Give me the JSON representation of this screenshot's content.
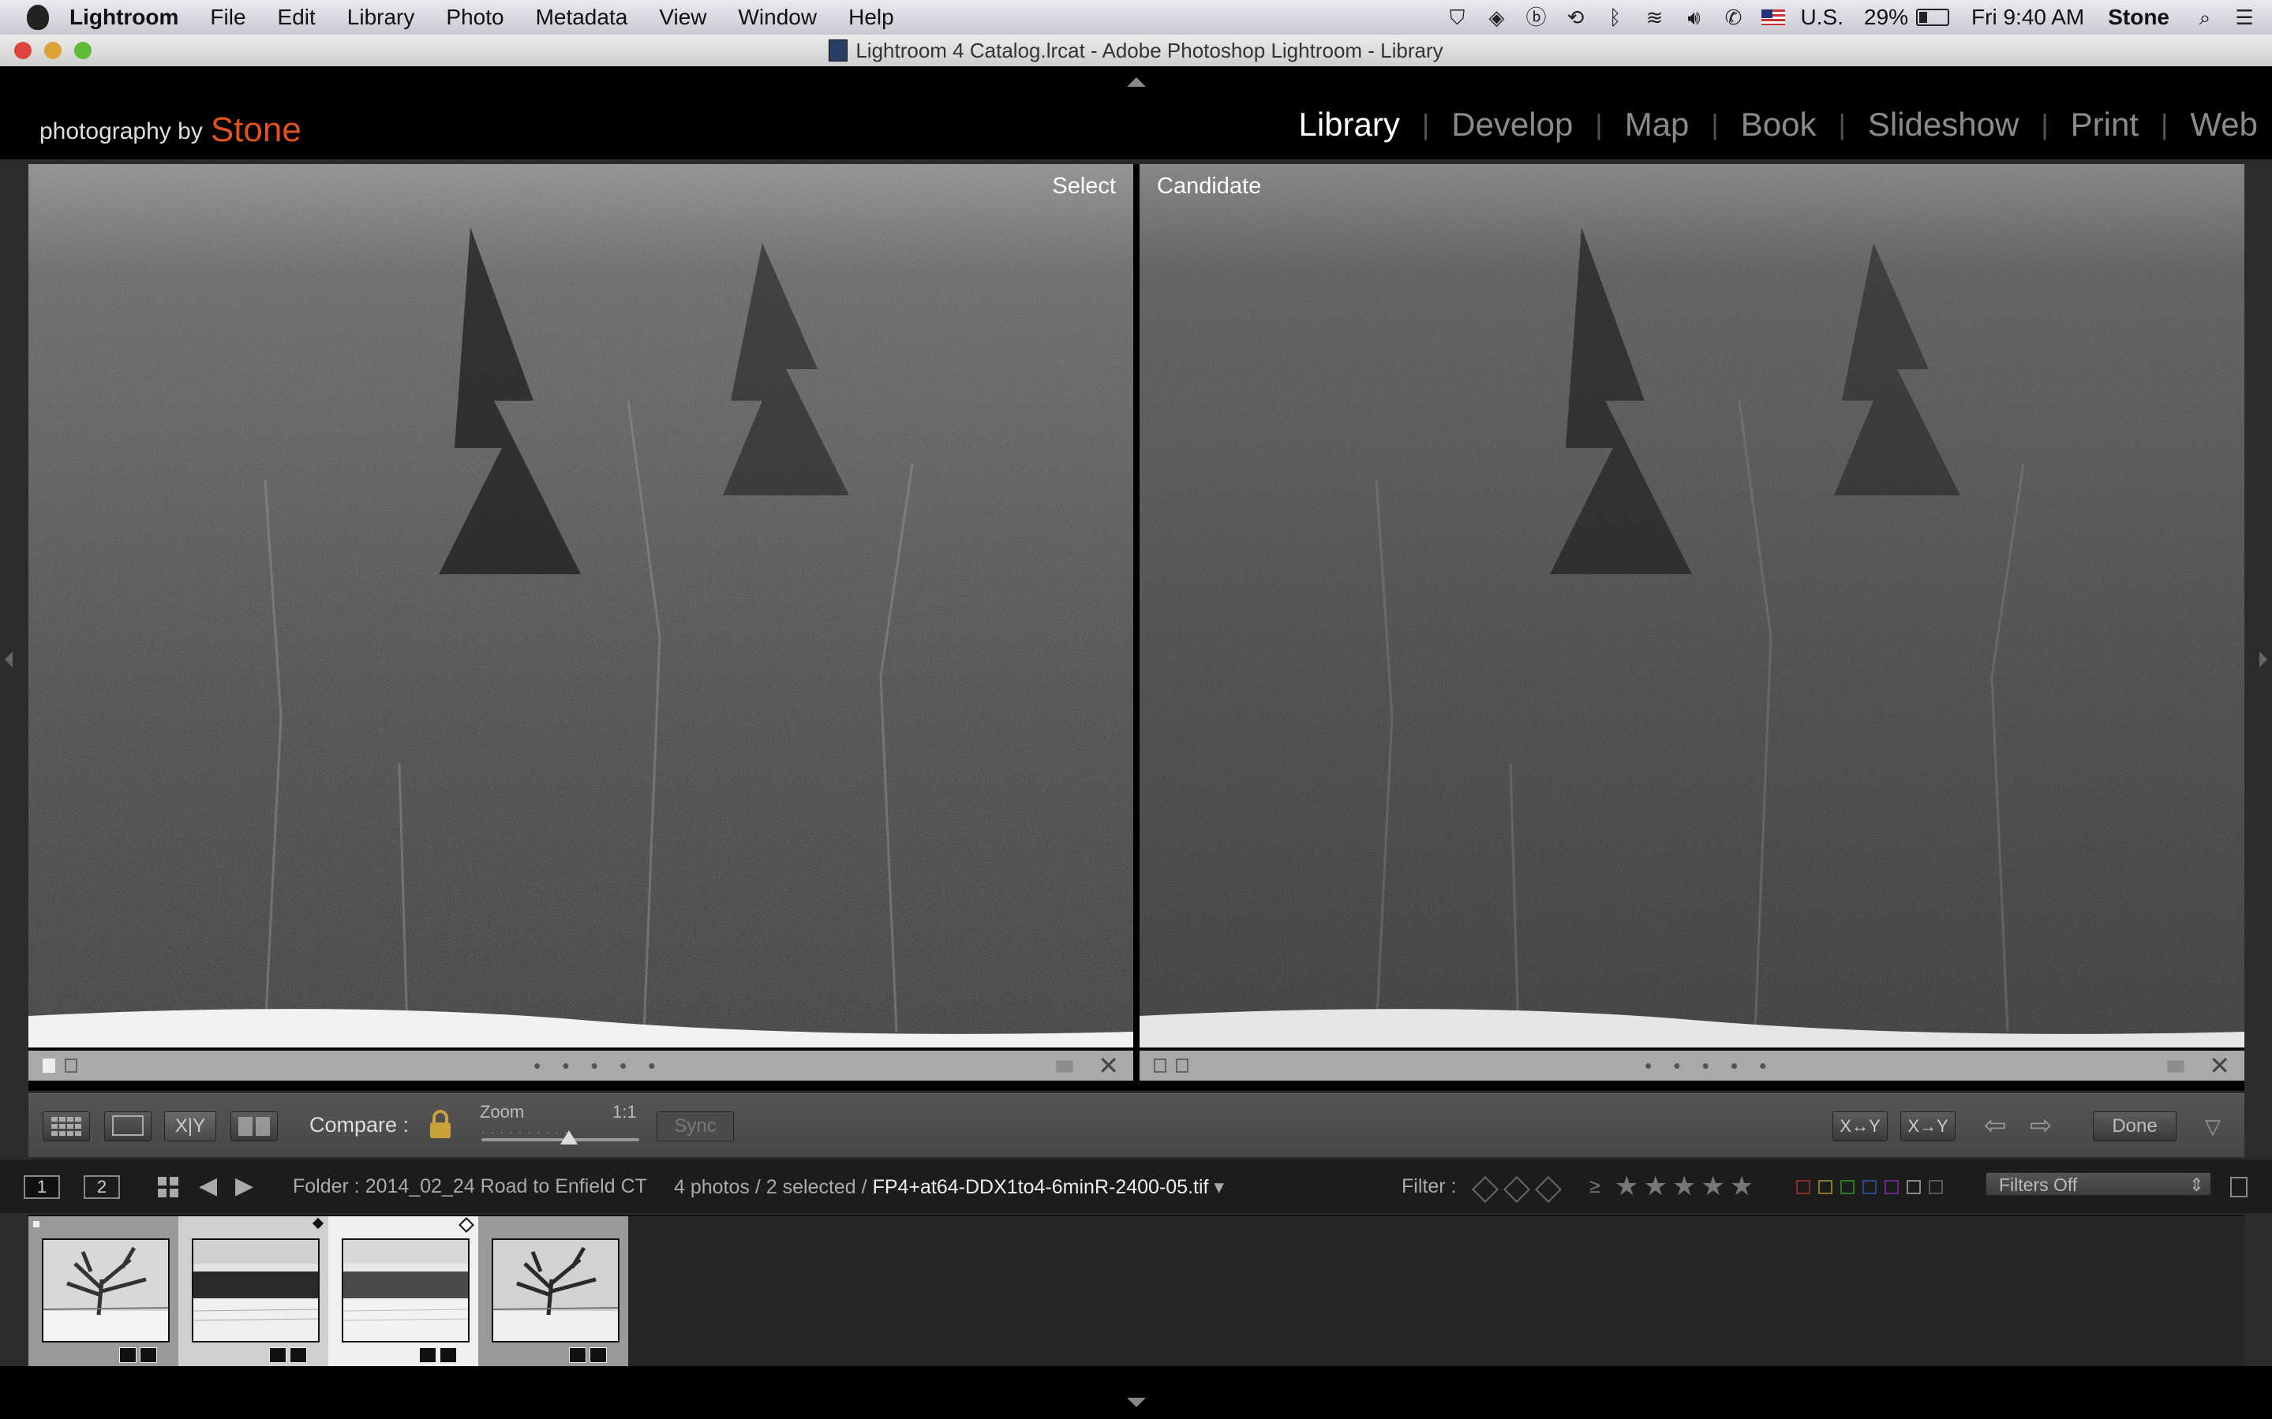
{
  "menubar": {
    "app": "Lightroom",
    "items": [
      "File",
      "Edit",
      "Library",
      "Photo",
      "Metadata",
      "View",
      "Window",
      "Help"
    ],
    "input_source": "U.S.",
    "battery": "29%",
    "clock": "Fri 9:40 AM",
    "user": "Stone"
  },
  "window": {
    "title": "Lightroom 4 Catalog.lrcat - Adobe Photoshop Lightroom - Library"
  },
  "identity": {
    "prefix": "photography by",
    "name": "Stone",
    "name_color": "#e2531a"
  },
  "modules": {
    "items": [
      "Library",
      "Develop",
      "Map",
      "Book",
      "Slideshow",
      "Print",
      "Web"
    ],
    "active": "Library"
  },
  "compare": {
    "select_label": "Select",
    "candidate_label": "Candidate",
    "info_dots": "• • • • •"
  },
  "toolbar": {
    "compare_label": "Compare :",
    "zoom_label": "Zoom",
    "zoom_value": "1:1",
    "sync_label": "Sync",
    "xy_label": "X|Y",
    "swap_label": "X↔Y",
    "make_select_label": "X→Y",
    "done_label": "Done"
  },
  "filmstrip_bar": {
    "page1": "1",
    "page2": "2",
    "folder": "Folder : 2014_02_24 Road to Enfield CT",
    "count": "4 photos / 2 selected /",
    "filename": "FP4+at64-DDX1to4-6minR-2400-05.tif",
    "filter_label": "Filter :",
    "gte": "≥",
    "stars": "★★★★★",
    "filters_value": "Filters Off"
  },
  "filmstrip": {
    "thumbnails": [
      {
        "subject": "tree",
        "state": "normal"
      },
      {
        "subject": "field",
        "state": "selected"
      },
      {
        "subject": "field",
        "state": "active"
      },
      {
        "subject": "tree",
        "state": "normal"
      }
    ]
  }
}
